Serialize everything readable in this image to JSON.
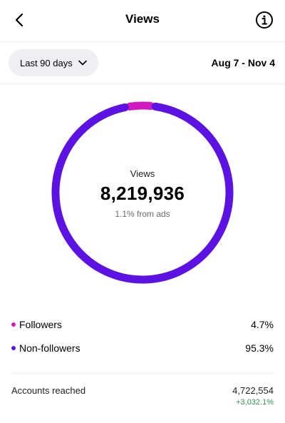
{
  "header": {
    "title": "Views",
    "back_icon": "chevron-left-icon",
    "info_icon": "info-icon"
  },
  "filter": {
    "range_label": "Last 90 days",
    "date_range": "Aug 7 - Nov 4"
  },
  "summary": {
    "label": "Views",
    "total": "8,219,936",
    "ads_note": "1.1% from ads"
  },
  "colors": {
    "followers": "#d318bf",
    "non_followers": "#5d12e4",
    "positive": "#2e9a48"
  },
  "breakdown": [
    {
      "label": "Followers",
      "percent": "4.7%",
      "share": 4.7
    },
    {
      "label": "Non-followers",
      "percent": "95.3%",
      "share": 95.3
    }
  ],
  "accounts_reached": {
    "label": "Accounts reached",
    "value": "4,722,554",
    "change": "+3,032.1%"
  }
}
